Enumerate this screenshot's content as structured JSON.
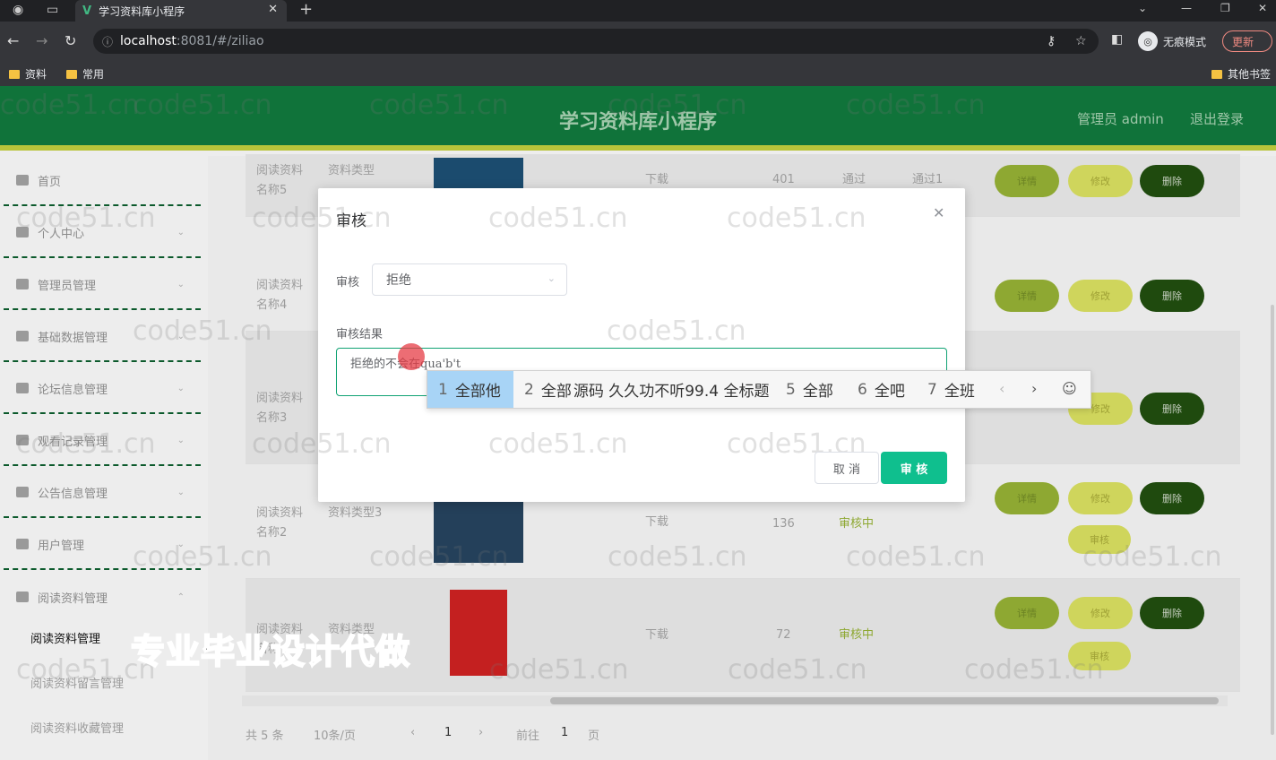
{
  "browser": {
    "tab_title": "学习资料库小程序",
    "url_host": "localhost",
    "url_path": ":8081/#/ziliao",
    "incognito_label": "无痕模式",
    "update_label": "更新",
    "bookmarks": [
      "资料",
      "常用"
    ],
    "other_bookmarks": "其他书签"
  },
  "header": {
    "title": "学习资料库小程序",
    "admin": "管理员 admin",
    "logout": "退出登录"
  },
  "sidebar": {
    "items": [
      "首页",
      "个人中心",
      "管理员管理",
      "基础数据管理",
      "论坛信息管理",
      "观看记录管理",
      "公告信息管理",
      "用户管理",
      "阅读资料管理"
    ],
    "sub_items": [
      "阅读资料管理",
      "阅读资料留言管理",
      "阅读资料收藏管理"
    ]
  },
  "table": {
    "rows": [
      {
        "name": "阅读资料名称5",
        "type": "资料类型",
        "download": "下载",
        "count": "401",
        "status": "通过",
        "result": "通过1"
      },
      {
        "name": "阅读资料名称4",
        "type": "",
        "download": "",
        "count": "",
        "status": "",
        "result": ""
      },
      {
        "name": "阅读资料名称3",
        "type": "",
        "download": "",
        "count": "",
        "status": "",
        "result": ""
      },
      {
        "name": "阅读资料名称2",
        "type": "资料类型3",
        "download": "下载",
        "count": "136",
        "status": "审核中",
        "result": ""
      },
      {
        "name": "阅读资料名称",
        "type": "资料类型",
        "download": "下载",
        "count": "72",
        "status": "审核中",
        "result": ""
      }
    ],
    "op_detail": "详情",
    "op_edit": "修改",
    "op_delete": "删除",
    "op_review": "审核"
  },
  "pager": {
    "total": "共 5 条",
    "size": "10条/页",
    "prev": "‹",
    "page": "1",
    "next": "›",
    "goto": "前往",
    "goto_page": "1",
    "page_unit": "页"
  },
  "dialog": {
    "title": "审核",
    "review_label": "审核",
    "review_value": "拒绝",
    "result_label": "审核结果",
    "result_text": "拒绝的不会在qua'b't",
    "cancel": "取 消",
    "confirm": "审 核"
  },
  "ime": {
    "candidates": [
      "全部他",
      "全部",
      "全部",
      "全部",
      "全部",
      "全吧",
      "全班"
    ],
    "overlap_text": "源码 久久功不听99.4 全标题"
  },
  "overlay": {
    "promo_text": "专业毕业设计代做",
    "watermark": "code51.cn"
  }
}
